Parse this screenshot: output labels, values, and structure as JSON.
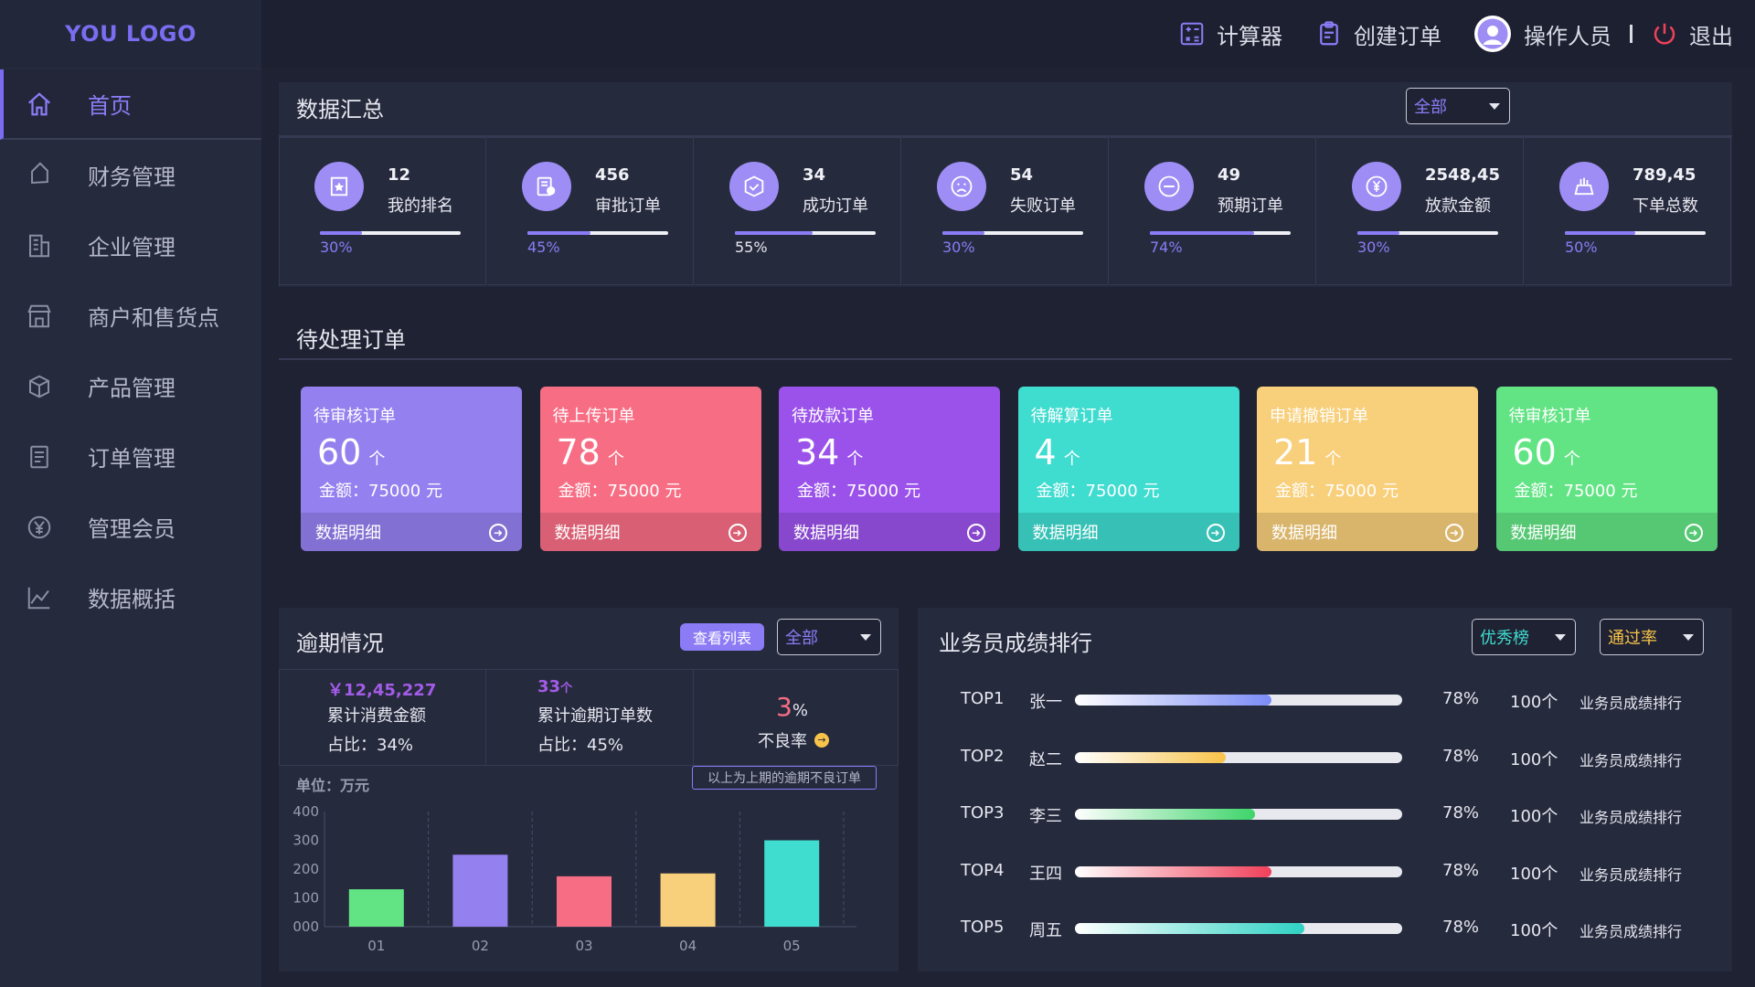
{
  "logo": "YOU LOGO",
  "sidebar": {
    "items": [
      {
        "label": "首页",
        "icon": "home-icon"
      },
      {
        "label": "财务管理",
        "icon": "tag-icon"
      },
      {
        "label": "企业管理",
        "icon": "building-icon"
      },
      {
        "label": "商户和售货点",
        "icon": "store-icon"
      },
      {
        "label": "产品管理",
        "icon": "box-icon"
      },
      {
        "label": "订单管理",
        "icon": "document-icon"
      },
      {
        "label": "管理会员",
        "icon": "yen-icon"
      },
      {
        "label": "数据概括",
        "icon": "chart-icon"
      }
    ]
  },
  "header": {
    "calculator": "计算器",
    "create_order": "创建订单",
    "operator": "操作人员",
    "logout": "退出"
  },
  "summary": {
    "title": "数据汇总",
    "filter": "全部",
    "stats": [
      {
        "value": "12",
        "label": "我的排名",
        "percent": "30%",
        "pct": 30
      },
      {
        "value": "456",
        "label": "审批订单",
        "percent": "45%",
        "pct": 45
      },
      {
        "value": "34",
        "label": "成功订单",
        "percent": "55%",
        "pct": 55
      },
      {
        "value": "54",
        "label": "失败订单",
        "percent": "30%",
        "pct": 30
      },
      {
        "value": "49",
        "label": "预期订单",
        "percent": "74%",
        "pct": 74
      },
      {
        "value": "2548,45",
        "label": "放款金额",
        "percent": "30%",
        "pct": 30
      },
      {
        "value": "789,45",
        "label": "下单总数",
        "percent": "50%",
        "pct": 50
      }
    ]
  },
  "pending": {
    "title": "待处理订单",
    "cards": [
      {
        "title": "待审核订单",
        "count": "60",
        "unit": "个",
        "amount": "金额：75000 元",
        "link": "数据明细",
        "color": "#9580ef"
      },
      {
        "title": "待上传订单",
        "count": "78",
        "unit": "个",
        "amount": "金额：75000 元",
        "link": "数据明细",
        "color": "#f76e84"
      },
      {
        "title": "待放款订单",
        "count": "34",
        "unit": "个",
        "amount": "金额：75000 元",
        "link": "数据明细",
        "color": "#9a52ea"
      },
      {
        "title": "待解算订单",
        "count": "4",
        "unit": "个",
        "amount": "金额：75000 元",
        "link": "数据明细",
        "color": "#3fdcd0"
      },
      {
        "title": "申请撤销订单",
        "count": "21",
        "unit": "个",
        "amount": "金额：75000 元",
        "link": "数据明细",
        "color": "#f8cf7a"
      },
      {
        "title": "待审核订单",
        "count": "60",
        "unit": "个",
        "amount": "金额：75000 元",
        "link": "数据明细",
        "color": "#62e484"
      }
    ]
  },
  "overdue": {
    "title": "逾期情况",
    "view_list": "查看列表",
    "filter": "全部",
    "box1": {
      "value": "￥12,45,227",
      "label": "累计消费金额",
      "ratio": "占比：34%"
    },
    "box2": {
      "value": "33",
      "unit": "个",
      "label": "累计逾期订单数",
      "ratio": "占比：45%"
    },
    "box3": {
      "value": "3",
      "unit": "%",
      "label": "不良率"
    },
    "tooltip": "以上为上期的逾期不良订单",
    "unit_label": "单位：万元"
  },
  "chart_data": {
    "type": "bar",
    "categories": [
      "01",
      "02",
      "03",
      "04",
      "05"
    ],
    "values": [
      130,
      250,
      175,
      185,
      300
    ],
    "colors": [
      "#62e484",
      "#9580ef",
      "#f76e84",
      "#f8cf7a",
      "#3fdcd0"
    ],
    "ylim": [
      0,
      400
    ],
    "yticks": [
      "000",
      "100",
      "200",
      "300",
      "400"
    ],
    "grid": "dashed-vertical"
  },
  "ranking": {
    "title": "业务员成绩排行",
    "filter1": "优秀榜",
    "filter2": "通过率",
    "rows": [
      {
        "rank": "TOP1",
        "name": "张一",
        "progress": 60,
        "rate": "78%",
        "count": "100个",
        "label": "业务员成绩排行",
        "grad": "linear-gradient(90deg,#ffffff,#7b8cf6)"
      },
      {
        "rank": "TOP2",
        "name": "赵二",
        "progress": 46,
        "rate": "78%",
        "count": "100个",
        "label": "业务员成绩排行",
        "grad": "linear-gradient(90deg,#ffffff,#f8c34a)"
      },
      {
        "rank": "TOP3",
        "name": "李三",
        "progress": 55,
        "rate": "78%",
        "count": "100个",
        "label": "业务员成绩排行",
        "grad": "linear-gradient(90deg,#ffffff,#3ed46a)"
      },
      {
        "rank": "TOP4",
        "name": "王四",
        "progress": 60,
        "rate": "78%",
        "count": "100个",
        "label": "业务员成绩排行",
        "grad": "linear-gradient(90deg,#ffffff,#f0405a)"
      },
      {
        "rank": "TOP5",
        "name": "周五",
        "progress": 70,
        "rate": "78%",
        "count": "100个",
        "label": "业务员成绩排行",
        "grad": "linear-gradient(90deg,#ffffff,#2fd2c4)"
      }
    ]
  }
}
